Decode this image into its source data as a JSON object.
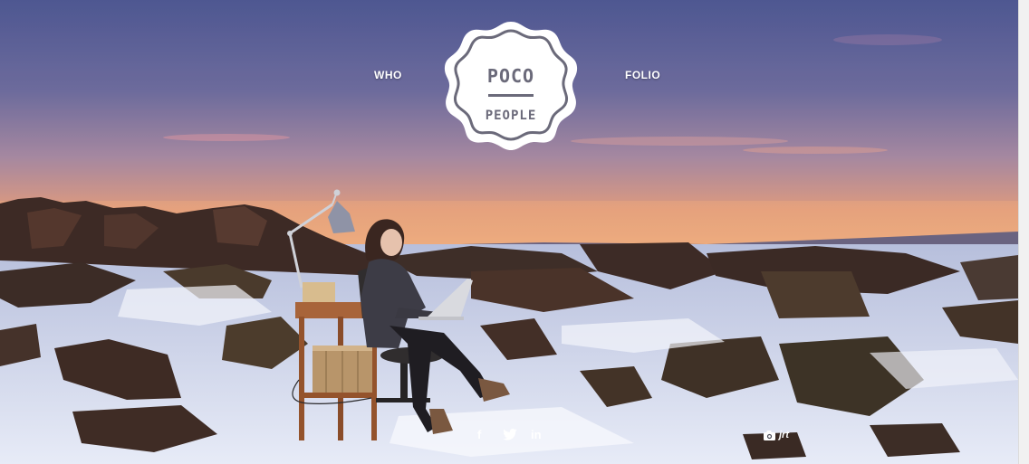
{
  "nav": {
    "left_label": "WHO",
    "right_label": "FOLIO"
  },
  "logo": {
    "line1": "POCO",
    "line2": "PEOPLE"
  },
  "social": {
    "facebook_glyph": "f",
    "linkedin_glyph": "in",
    "icons": [
      "facebook-icon",
      "twitter-icon",
      "linkedin-icon"
    ]
  },
  "credit": {
    "label": "jrt",
    "icon": "camera-icon"
  },
  "colors": {
    "logo_ink": "#6b6a7a",
    "text": "#ffffff"
  }
}
